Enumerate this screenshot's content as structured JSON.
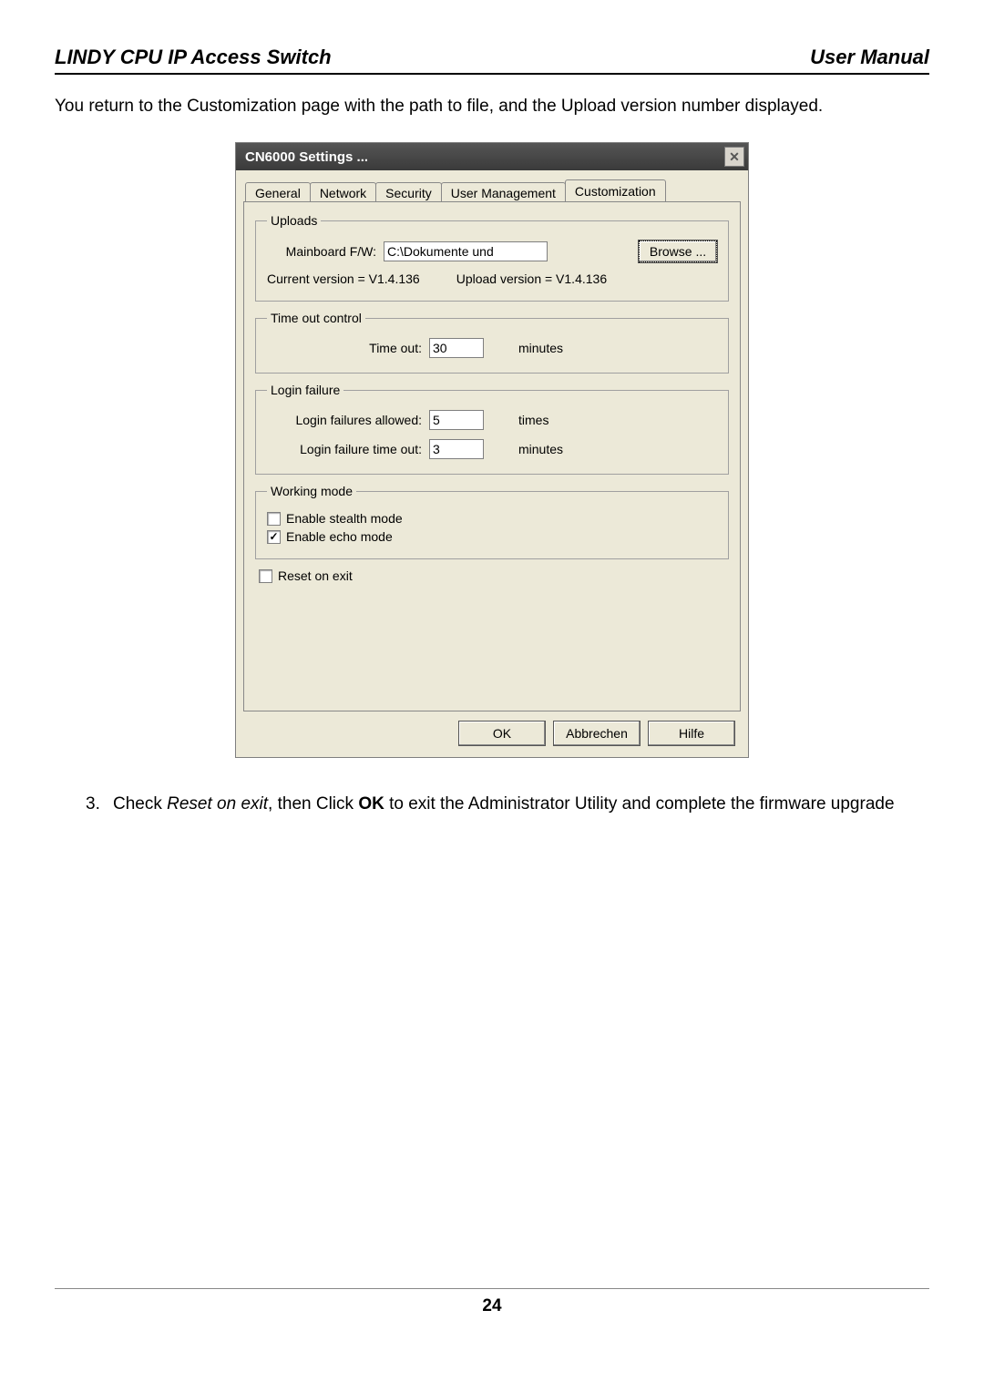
{
  "header": {
    "left": "LINDY CPU IP Access Switch",
    "right": "User Manual"
  },
  "intro": "You return to the Customization page with the path to file, and the Upload version number displayed.",
  "dialog": {
    "title": "CN6000 Settings ...",
    "tabs": {
      "general": "General",
      "network": "Network",
      "security": "Security",
      "userMgmt": "User Management",
      "customization": "Customization"
    },
    "uploads": {
      "legend": "Uploads",
      "mainboardLabel": "Mainboard F/W:",
      "mainboardValue": "C:\\Dokumente und",
      "browse": "Browse ...",
      "currentVersion": "Current version = V1.4.136",
      "uploadVersion": "Upload version = V1.4.136"
    },
    "timeout": {
      "legend": "Time out control",
      "label": "Time out:",
      "value": "30",
      "unit": "minutes"
    },
    "loginFailure": {
      "legend": "Login failure",
      "allowedLabel": "Login failures allowed:",
      "allowedValue": "5",
      "allowedUnit": "times",
      "timeoutLabel": "Login failure time out:",
      "timeoutValue": "3",
      "timeoutUnit": "minutes"
    },
    "workingMode": {
      "legend": "Working mode",
      "stealth": "Enable stealth mode",
      "echo": "Enable echo mode"
    },
    "resetOnExit": "Reset on exit",
    "buttons": {
      "ok": "OK",
      "cancel": "Abbrechen",
      "help": "Hilfe"
    }
  },
  "instruction": {
    "num": "3.",
    "pre": "Check ",
    "italic": "Reset on exit",
    "mid": ", then Click ",
    "bold": "OK",
    "post": " to exit the Administrator Utility and complete the firmware upgrade"
  },
  "footer": {
    "pageNumber": "24"
  }
}
